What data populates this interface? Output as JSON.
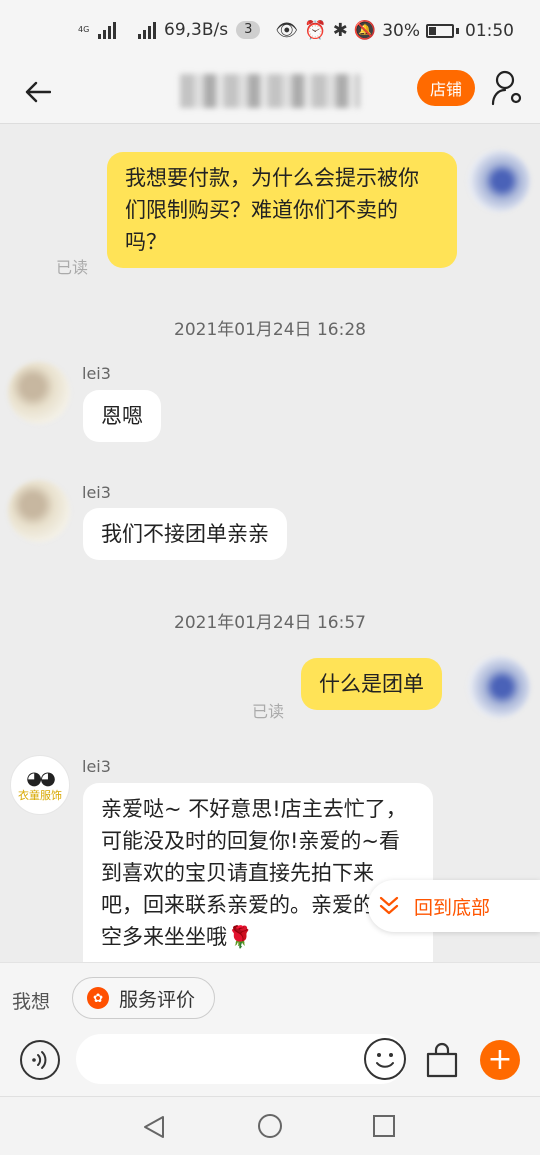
{
  "status_bar": {
    "network_tag": "4G",
    "speed": "69,3B/s",
    "notif_count": "3",
    "battery": "30%",
    "time": "01:50"
  },
  "nav": {
    "shop_label": "店铺"
  },
  "messages": {
    "m1": "我想要付款，为什么会提示被你们限制购买？难道你们不卖的吗？",
    "m1_read": "已读",
    "time1": "2021年01月24日 16:28",
    "m2_sender": "lei3",
    "m2": "恩嗯",
    "m3_sender": "lei3",
    "m3": "我们不接团单亲亲",
    "time2": "2021年01月24日 16:57",
    "m4": "什么是团单",
    "m4_read": "已读",
    "m5_sender": "lei3",
    "m5": "亲爱哒~ 不好意思!店主去忙了，可能没及时的回复你!亲爱的~看到喜欢的宝贝请直接先拍下来吧，回来联系亲爱的。亲爱的有空多来坐坐哦🌹"
  },
  "shop_avatar_text": "衣童服饰",
  "back_to_bottom": "回到底部",
  "quick": {
    "prefix": "我想",
    "service_review": "服务评价"
  },
  "input": {
    "placeholder": ""
  },
  "colors": {
    "accent": "#ff6a00",
    "my_bubble": "#ffe357",
    "background": "#ededed"
  }
}
